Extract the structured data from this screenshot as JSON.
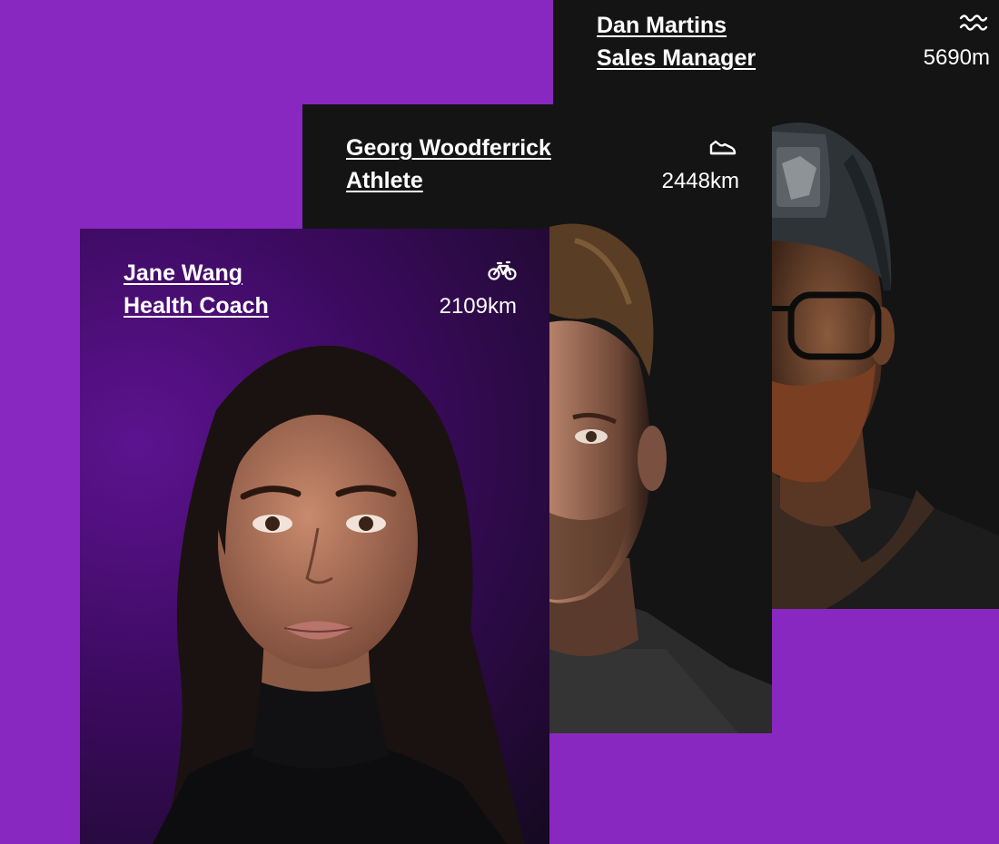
{
  "cards": [
    {
      "name": "Dan Martins",
      "role": "Sales Manager",
      "distance": "5690m",
      "sport_icon": "swim-waves-icon"
    },
    {
      "name": "Georg Woodferrick",
      "role": "Athlete",
      "distance": "2448km",
      "sport_icon": "running-shoe-icon"
    },
    {
      "name": "Jane Wang",
      "role": "Health Coach",
      "distance": "2109km",
      "sport_icon": "bicycle-icon"
    }
  ],
  "colors": {
    "background": "#8928c1",
    "card_dark": "#141414",
    "jane_card_purple": "#5d1390",
    "text": "#ffffff"
  }
}
